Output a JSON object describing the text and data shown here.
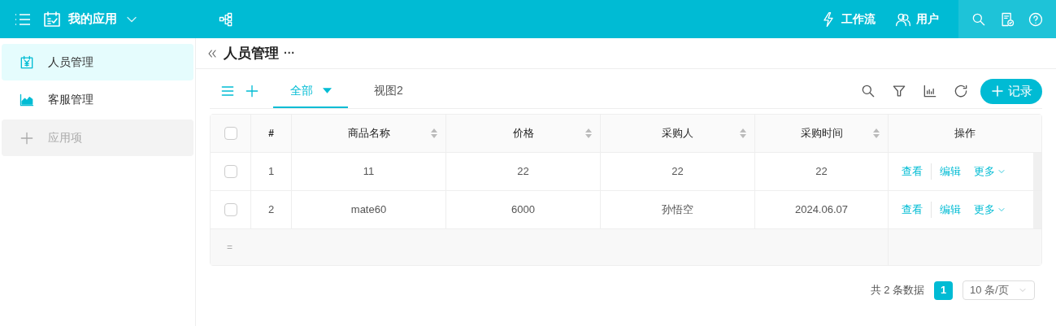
{
  "topbar": {
    "app_title": "我的应用",
    "links": [
      {
        "kind": "workflow",
        "label": "工作流"
      },
      {
        "kind": "users",
        "label": "用户"
      }
    ]
  },
  "sidebar": {
    "items": [
      {
        "kind": "yen",
        "label": "人员管理",
        "selected": true
      },
      {
        "kind": "chart",
        "label": "客服管理",
        "selected": false
      }
    ],
    "add_item": "应用项"
  },
  "page": {
    "title": "人员管理",
    "more": "···"
  },
  "views": [
    {
      "label": "全部",
      "selected": true
    },
    {
      "label": "视图2",
      "selected": false
    }
  ],
  "add_record": "记录",
  "table": {
    "columns": [
      {
        "label": "#",
        "sortable": false
      },
      {
        "label": "商品名称",
        "sortable": true
      },
      {
        "label": "价格",
        "sortable": true
      },
      {
        "label": "采购人",
        "sortable": true
      },
      {
        "label": "采购时间",
        "sortable": true
      },
      {
        "label": "操作",
        "sortable": false
      }
    ],
    "all_checked": false,
    "rows": [
      {
        "checked": false,
        "cells": [
          "1",
          "11",
          "22",
          "22",
          "22"
        ],
        "actions": [
          "查看",
          "编辑",
          "更多"
        ]
      },
      {
        "checked": false,
        "cells": [
          "2",
          "mate60",
          "6000",
          "孙悟空",
          "2024.06.07"
        ],
        "actions": [
          "查看",
          "编辑",
          "更多"
        ]
      }
    ],
    "summary": "="
  },
  "pagination": {
    "total": "共 2 条数据",
    "pages": [
      {
        "label": "1",
        "selected": true
      }
    ],
    "page_size": "10 条/页"
  }
}
